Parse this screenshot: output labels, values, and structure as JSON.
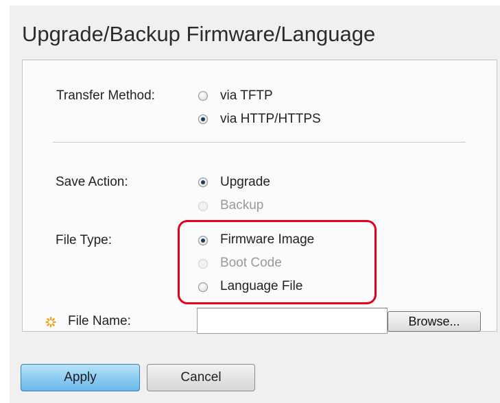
{
  "page": {
    "title": "Upgrade/Backup Firmware/Language"
  },
  "form": {
    "transfer_method": {
      "label": "Transfer Method:",
      "options": [
        {
          "label": "via TFTP",
          "checked": false,
          "disabled": false
        },
        {
          "label": "via HTTP/HTTPS",
          "checked": true,
          "disabled": false
        }
      ]
    },
    "save_action": {
      "label": "Save Action:",
      "options": [
        {
          "label": "Upgrade",
          "checked": true,
          "disabled": false
        },
        {
          "label": "Backup",
          "checked": false,
          "disabled": true
        }
      ]
    },
    "file_type": {
      "label": "File Type:",
      "options": [
        {
          "label": "Firmware Image",
          "checked": true,
          "disabled": false
        },
        {
          "label": "Boot Code",
          "checked": false,
          "disabled": true
        },
        {
          "label": "Language File",
          "checked": false,
          "disabled": false
        }
      ]
    },
    "file_name": {
      "label": "File Name:",
      "value": "",
      "required_icon": "required-asterisk-icon",
      "browse_label": "Browse..."
    }
  },
  "actions": {
    "apply_label": "Apply",
    "cancel_label": "Cancel"
  },
  "colors": {
    "highlight": "#e3001b",
    "apply_button": "#8fcdf3",
    "required_icon": "#f2a01e"
  }
}
